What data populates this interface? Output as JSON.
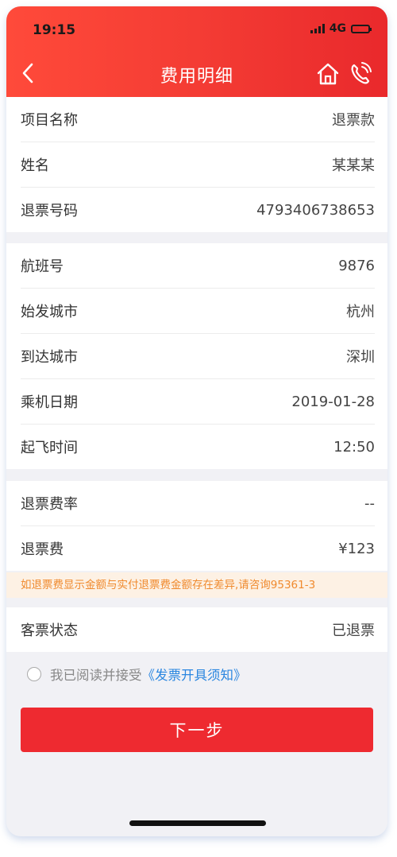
{
  "status_bar": {
    "time": "19:15",
    "network": "4G"
  },
  "nav": {
    "title": "费用明细"
  },
  "section1": [
    {
      "label": "项目名称",
      "value": "退票款"
    },
    {
      "label": "姓名",
      "value": "某某某"
    },
    {
      "label": "退票号码",
      "value": "4793406738653"
    }
  ],
  "section2": [
    {
      "label": "航班号",
      "value": "9876"
    },
    {
      "label": "始发城市",
      "value": "杭州"
    },
    {
      "label": "到达城市",
      "value": "深圳"
    },
    {
      "label": "乘机日期",
      "value": "2019-01-28"
    },
    {
      "label": "起飞时间",
      "value": "12:50"
    }
  ],
  "section3": [
    {
      "label": "退票费率",
      "value": "--"
    },
    {
      "label": "退票费",
      "value": "¥123"
    }
  ],
  "notice": "如退票费显示金额与实付退票费金额存在差异,请咨询95361-3",
  "section4": [
    {
      "label": "客票状态",
      "value": "已退票"
    }
  ],
  "agreement": {
    "text": "我已阅读并接受",
    "link": "《发票开具须知》"
  },
  "next_button": "下一步",
  "colors": {
    "header_start": "#ff4a3a",
    "header_end": "#e9292c",
    "button": "#ee2a30",
    "link": "#2a86e0",
    "notice_text": "#f08a2e"
  }
}
